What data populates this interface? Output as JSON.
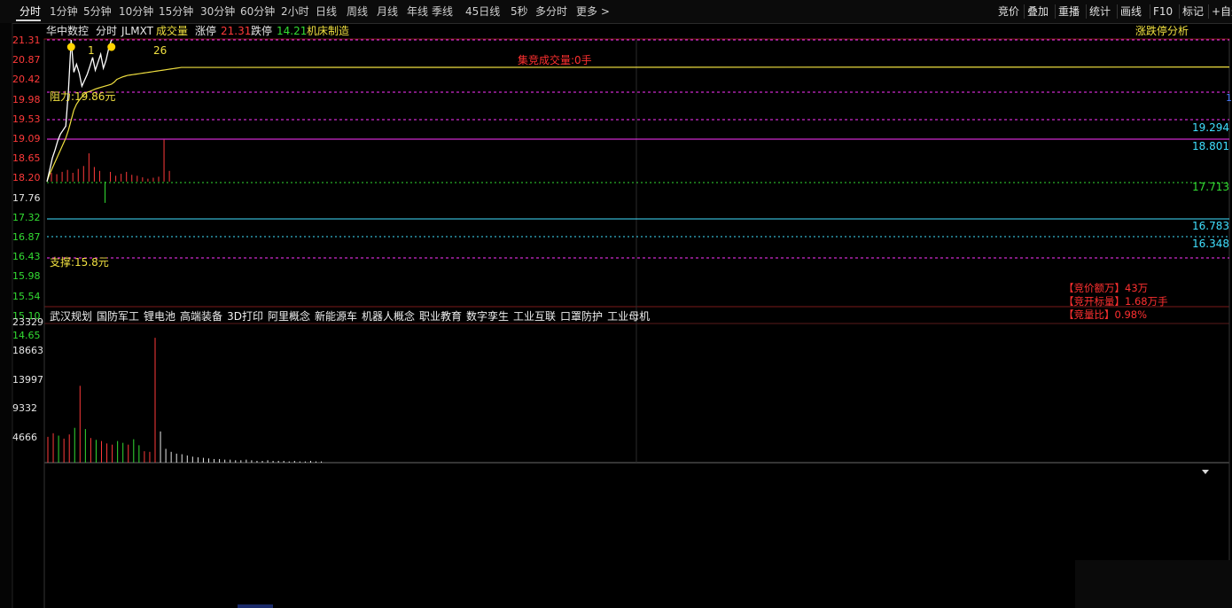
{
  "toolbar": {
    "timeframes": [
      "分时",
      "1分钟",
      "5分钟",
      "10分钟",
      "15分钟",
      "30分钟",
      "60分钟",
      "2小时",
      "日线",
      "周线",
      "月线",
      "年线",
      "季线",
      "45日线",
      "5秒",
      "多分时",
      "更多 >"
    ],
    "active_index": 0,
    "right_tools": [
      "竞价",
      "叠加",
      "重播",
      "统计",
      "画线",
      "F10",
      "标记",
      "+自选"
    ]
  },
  "header": {
    "stock_name": "华中数控",
    "mode": "分时",
    "code": "JLMXT",
    "volume_label": "成交量",
    "limit_up_label": "涨停",
    "limit_up_value": "21.31",
    "limit_down_label": "跌停",
    "limit_down_value": "14.21",
    "industry": "机床制造",
    "analysis_button": "涨跌停分析"
  },
  "price_axis": {
    "labels": [
      "21.31",
      "20.87",
      "20.42",
      "19.98",
      "19.53",
      "19.09",
      "18.65",
      "18.20",
      "17.76",
      "17.32",
      "16.87",
      "16.43",
      "15.98",
      "15.54",
      "15.10",
      "14.65"
    ],
    "colors": [
      "red",
      "red",
      "red",
      "red",
      "red",
      "red",
      "red",
      "red",
      "white",
      "green",
      "green",
      "green",
      "green",
      "green",
      "green",
      "green"
    ]
  },
  "volume_axis": {
    "labels": [
      "23329",
      "18663",
      "13997",
      "9332",
      "4666"
    ]
  },
  "annotations": {
    "resistance": "阻力:19.86元",
    "support": "支撑:15.8元",
    "auction_volume": "集竞成交量:0手",
    "marker_1": "1",
    "marker_2": "26"
  },
  "level_lines": {
    "labels": [
      "19.294",
      "18.801",
      "17.713",
      "16.783",
      "16.348"
    ],
    "right_edge_marker": "1"
  },
  "concepts": [
    "武汉规划",
    "国防军工",
    "锂电池",
    "高端装备",
    "3D打印",
    "阿里概念",
    "新能源车",
    "机器人概念",
    "职业教育",
    "数字孪生",
    "工业互联",
    "口罩防护",
    "工业母机"
  ],
  "auction_info": {
    "amount": "【竞价额万】43万",
    "open_volume": "【竞开标量】1.68万手",
    "ratio": "【竞量比】0.98%"
  },
  "colors": {
    "up": "#ff3a3a",
    "down": "#33dd33",
    "price_line": "#ffffff",
    "avg_line": "#f0e040",
    "magenta": "#ff33ff",
    "cyan": "#40e0ff"
  },
  "chart_data": {
    "type": "line",
    "price_range": [
      14.65,
      21.31
    ],
    "reference_price": 17.76,
    "price": [
      17.76,
      18.05,
      18.35,
      18.55,
      18.78,
      18.95,
      19.05,
      19.15,
      20.05,
      21.31,
      20.5,
      20.7,
      20.48,
      20.15,
      20.3,
      20.45,
      20.65,
      20.87,
      20.55,
      20.75,
      20.95,
      20.6,
      20.8,
      21.1,
      21.31
    ],
    "avg_price": [
      17.76,
      17.95,
      18.1,
      18.25,
      18.4,
      18.55,
      18.7,
      18.85,
      19.05,
      19.3,
      19.55,
      19.7,
      19.8,
      19.88,
      19.95,
      20.0,
      20.02,
      20.05,
      20.08,
      20.1,
      20.12,
      20.14,
      20.16,
      20.18,
      20.2,
      20.25,
      20.32,
      20.35,
      20.38,
      20.4,
      20.42,
      20.43,
      20.44,
      20.45,
      20.46,
      20.47,
      20.48,
      20.49,
      20.5,
      20.51,
      20.52,
      20.53,
      20.54,
      20.55,
      20.56,
      20.57,
      20.58,
      20.59,
      20.6,
      20.61,
      20.62,
      20.63
    ],
    "lower_bars": [
      0.45,
      0.38,
      0.5,
      0.6,
      0.45,
      0.65,
      0.8,
      1.45,
      0.75,
      0.55,
      0.6,
      0.5,
      0.3,
      0.4,
      0.5,
      0.35,
      0.3,
      0.22,
      0.15,
      0.2,
      0.25,
      2.15,
      0.55
    ],
    "volume_range": [
      0,
      23329
    ],
    "volume": [
      4300,
      4900,
      4500,
      4000,
      4700,
      5800,
      12800,
      5600,
      4100,
      3800,
      3600,
      3200,
      3000,
      3600,
      3300,
      3000,
      3900,
      2900,
      1900,
      1800,
      20800,
      5200,
      2300,
      1800,
      1500,
      1400,
      1200,
      1000,
      900,
      800,
      700,
      600,
      600,
      500,
      500,
      400,
      400,
      500,
      400,
      300,
      300,
      400,
      300,
      300,
      300,
      200,
      300,
      200,
      200,
      300,
      200,
      200
    ],
    "volume_colors": [
      "r",
      "r",
      "g",
      "r",
      "r",
      "g",
      "r",
      "g",
      "r",
      "g",
      "r",
      "r",
      "r",
      "g",
      "g",
      "r",
      "g",
      "g",
      "r",
      "r",
      "r",
      "w",
      "w",
      "w",
      "w",
      "w",
      "w",
      "w",
      "w",
      "w",
      "w",
      "w",
      "w",
      "w",
      "w",
      "w",
      "w",
      "w",
      "w",
      "w",
      "w",
      "w",
      "w",
      "w",
      "w",
      "w",
      "w",
      "w",
      "w",
      "w",
      "w",
      "w"
    ]
  }
}
